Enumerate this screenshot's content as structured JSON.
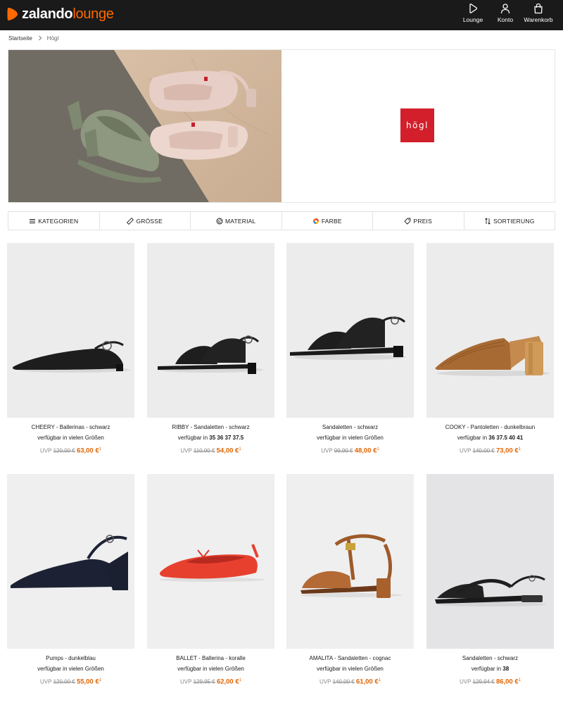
{
  "header": {
    "logo_main": "zalando",
    "logo_accent": "lounge",
    "nav": [
      {
        "label": "Lounge",
        "icon": "play-icon"
      },
      {
        "label": "Konto",
        "icon": "user-icon"
      },
      {
        "label": "Warenkorb",
        "icon": "bag-icon"
      }
    ]
  },
  "breadcrumb": {
    "home": "Startseite",
    "current": "Högl"
  },
  "banner": {
    "brand_logo_text": "högl",
    "brand_color": "#d21f2b"
  },
  "filters": [
    {
      "label": "KATEGORIEN",
      "icon": "menu-icon"
    },
    {
      "label": "GRÖSSE",
      "icon": "ruler-icon"
    },
    {
      "label": "MATERIAL",
      "icon": "material-icon"
    },
    {
      "label": "FARBE",
      "icon": "color-wheel-icon"
    },
    {
      "label": "PREIS",
      "icon": "price-tag-icon"
    },
    {
      "label": "SORTIERUNG",
      "icon": "sort-icon"
    }
  ],
  "accent_color": "#e06300",
  "products": [
    {
      "name": "CHEERY - Ballerinas - schwarz",
      "avail_prefix": "verfügbar in vielen Größen",
      "sizes": "",
      "uvp": "UVP",
      "old_price": "120,00 €",
      "new_price": "63,00 €",
      "sup": "1"
    },
    {
      "name": "RIBBY - Sandaletten - schwarz",
      "avail_prefix": "verfügbar in",
      "sizes": "35 36 37 37.5",
      "uvp": "UVP",
      "old_price": "110,00 €",
      "new_price": "54,00 €",
      "sup": "1"
    },
    {
      "name": "Sandaletten - schwarz",
      "avail_prefix": "verfügbar in vielen Größen",
      "sizes": "",
      "uvp": "UVP",
      "old_price": "99,90 €",
      "new_price": "48,00 €",
      "sup": "1"
    },
    {
      "name": "COOKY - Pantoletten - dunkelbraun",
      "avail_prefix": "verfügbar in",
      "sizes": "36 37.5 40 41",
      "uvp": "UVP",
      "old_price": "140,00 €",
      "new_price": "73,00 €",
      "sup": "1"
    },
    {
      "name": "Pumps - dunkelblau",
      "avail_prefix": "verfügbar in vielen Größen",
      "sizes": "",
      "uvp": "UVP",
      "old_price": "120,00 €",
      "new_price": "55,00 €",
      "sup": "1"
    },
    {
      "name": "BALLET - Ballerina - koralle",
      "avail_prefix": "verfügbar in vielen Größen",
      "sizes": "",
      "uvp": "UVP",
      "old_price": "129,95 €",
      "new_price": "62,00 €",
      "sup": "1"
    },
    {
      "name": "AMALITA - Sandaletten - cognac",
      "avail_prefix": "verfügbar in vielen Größen",
      "sizes": "",
      "uvp": "UVP",
      "old_price": "140,00 €",
      "new_price": "61,00 €",
      "sup": "1"
    },
    {
      "name": "Sandaletten - schwarz",
      "avail_prefix": "verfügbar in",
      "sizes": "38",
      "uvp": "UVP",
      "old_price": "129,94 €",
      "new_price": "86,00 €",
      "sup": "1"
    }
  ]
}
